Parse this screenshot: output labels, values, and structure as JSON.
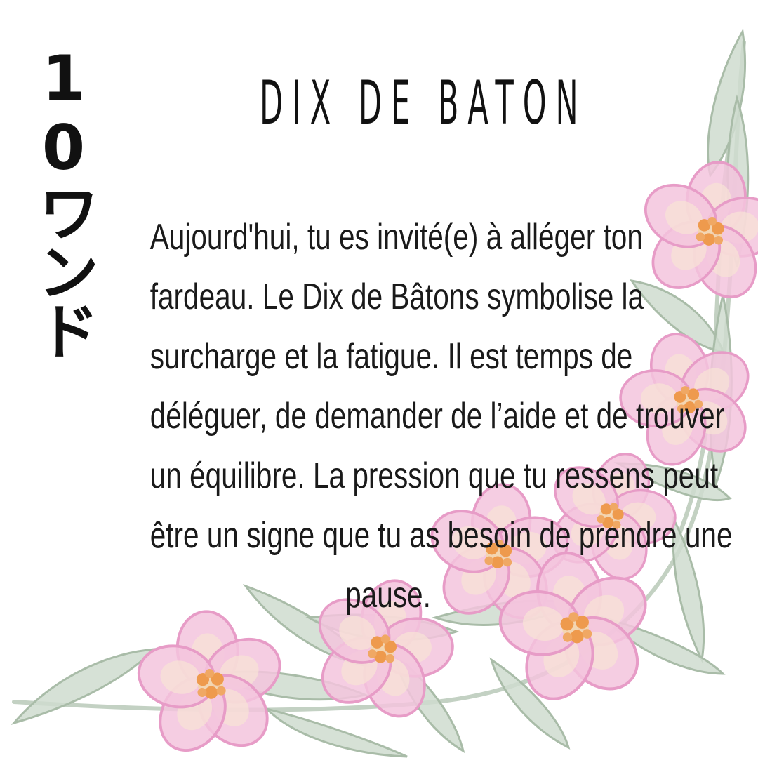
{
  "card": {
    "vertical_label": "10ワンド",
    "title": "DIX DE BATON",
    "paragraph_lines": [
      "Aujourd'hui, tu es invité(e) à alléger ton",
      "fardeau. Le Dix de Bâtons symbolise la",
      "surcharge et la fatigue. Il est temps de",
      "déléguer, de demander de l’aide et de trouver",
      "un équilibre. La pression que tu ressens peut",
      "être un signe que tu as besoin de prendre une",
      "pause."
    ]
  },
  "decoration": {
    "flower_petal_color": "#f3c4dd",
    "flower_edge_color": "#e79cc7",
    "flower_center_color": "#ee9a4d",
    "leaf_color": "#cfdccf",
    "leaf_edge_color": "#a9bca8"
  }
}
